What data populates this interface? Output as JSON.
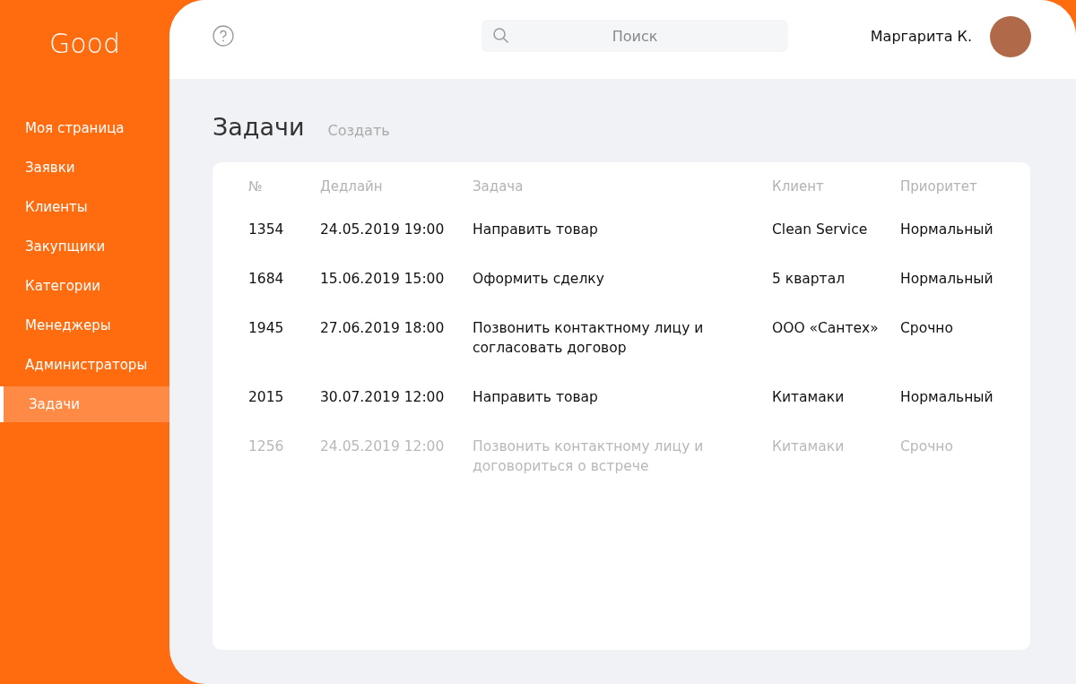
{
  "brand": "Good",
  "sidebar": {
    "items": [
      {
        "label": "Моя страница",
        "selected": false
      },
      {
        "label": "Заявки",
        "selected": false
      },
      {
        "label": "Клиенты",
        "selected": false
      },
      {
        "label": "Закупщики",
        "selected": false
      },
      {
        "label": "Категории",
        "selected": false
      },
      {
        "label": "Менеджеры",
        "selected": false
      },
      {
        "label": "Администраторы",
        "selected": false
      },
      {
        "label": "Задачи",
        "selected": true
      }
    ]
  },
  "search": {
    "placeholder": "Поиск"
  },
  "user": {
    "name": "Маргарита К."
  },
  "page": {
    "title": "Задачи",
    "create_link": "Создать"
  },
  "table": {
    "columns": [
      "№",
      "Дедлайн",
      "Задача",
      "Клиент",
      "Приоритет"
    ],
    "rows": [
      {
        "cells": [
          "1354",
          "24.05.2019 19:00",
          "Направить товар",
          "Clean Service",
          "Нормальный"
        ],
        "completed": false
      },
      {
        "cells": [
          "1684",
          "15.06.2019 15:00",
          "Оформить сделку",
          "5 квартал",
          "Нормальный"
        ],
        "completed": false
      },
      {
        "cells": [
          "1945",
          "27.06.2019 18:00",
          "Позвонить контактному лицу и согласовать договор",
          "ООО «Сантех»",
          "Срочно"
        ],
        "completed": false
      },
      {
        "cells": [
          "2015",
          "30.07.2019 12:00",
          "Направить товар",
          "Китамаки",
          "Нормальный"
        ],
        "completed": false
      },
      {
        "cells": [
          "1256",
          "24.05.2019 12:00",
          "Позвонить контактному лицу и договориться о встрече",
          "Китамаки",
          "Срочно"
        ],
        "completed": true
      }
    ]
  }
}
